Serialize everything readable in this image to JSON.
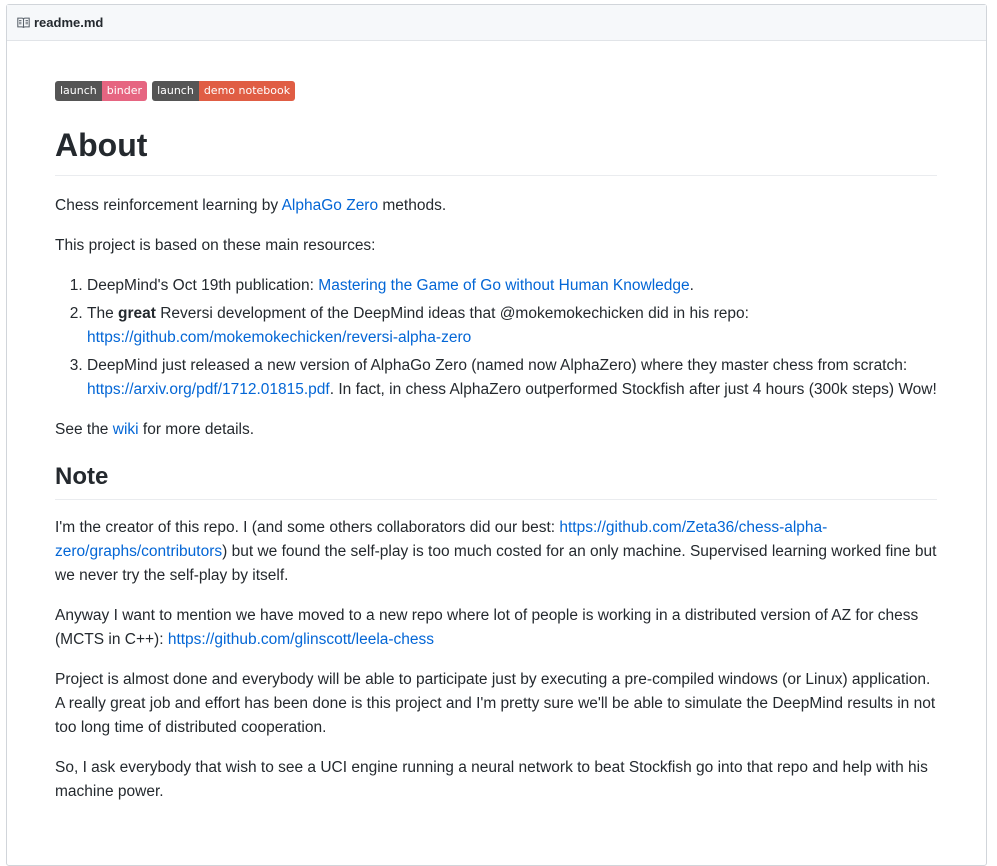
{
  "header": {
    "filename": "readme.md",
    "icon": "book-icon"
  },
  "badges": [
    {
      "left": "launch",
      "right": "binder",
      "color": "#e66581"
    },
    {
      "left": "launch",
      "right": "demo notebook",
      "color": "#e05d44"
    }
  ],
  "about": {
    "title": "About",
    "p1_pre": "Chess reinforcement learning by ",
    "p1_link": "AlphaGo Zero",
    "p1_post": " methods.",
    "p2": "This project is based on these main resources:",
    "items": [
      {
        "pre": "DeepMind's Oct 19th publication: ",
        "link": "Mastering the Game of Go without Human Knowledge",
        "post": "."
      },
      {
        "pre": "The ",
        "bold": "great",
        "mid": " Reversi development of the DeepMind ideas that @mokemokechicken did in his repo: ",
        "link": "https://github.com/mokemokechicken/reversi-alpha-zero"
      },
      {
        "pre": "DeepMind just released a new version of AlphaGo Zero (named now AlphaZero) where they master chess from scratch: ",
        "link": "https://arxiv.org/pdf/1712.01815.pdf",
        "post": ". In fact, in chess AlphaZero outperformed Stockfish after just 4 hours (300k steps) Wow!"
      }
    ],
    "p3_pre": "See the ",
    "p3_link": "wiki",
    "p3_post": " for more details."
  },
  "note": {
    "title": "Note",
    "p1_pre": "I'm the creator of this repo. I (and some others collaborators did our best: ",
    "p1_link": "https://github.com/Zeta36/chess-alpha-zero/graphs/contributors",
    "p1_post": ") but we found the self-play is too much costed for an only machine. Supervised learning worked fine but we never try the self-play by itself.",
    "p2_pre": "Anyway I want to mention we have moved to a new repo where lot of people is working in a distributed version of AZ for chess (MCTS in C++): ",
    "p2_link": "https://github.com/glinscott/leela-chess",
    "p3": "Project is almost done and everybody will be able to participate just by executing a pre-compiled windows (or Linux) application. A really great job and effort has been done is this project and I'm pretty sure we'll be able to simulate the DeepMind results in not too long time of distributed cooperation.",
    "p4": "So, I ask everybody that wish to see a UCI engine running a neural network to beat Stockfish go into that repo and help with his machine power."
  }
}
